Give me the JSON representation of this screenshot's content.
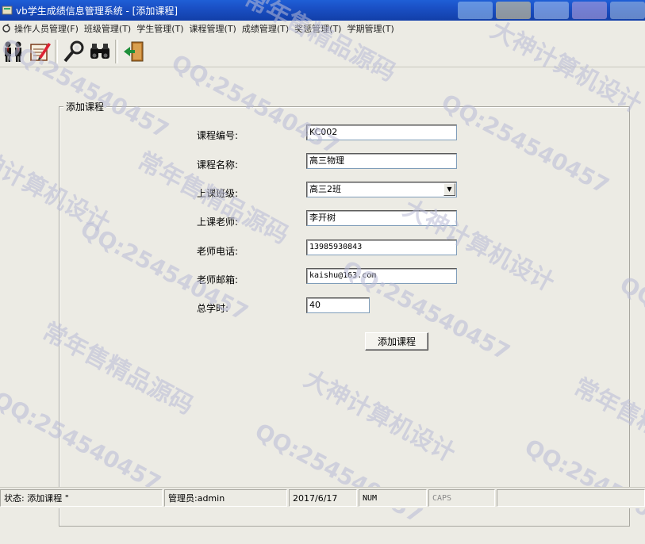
{
  "window": {
    "title": "vb学生成绩信息管理系统 - [添加课程]"
  },
  "menu": [
    "操作人员管理(F)",
    "班级管理(T)",
    "学生管理(T)",
    "课程管理(T)",
    "成绩管理(T)",
    "奖惩管理(T)",
    "学期管理(T)"
  ],
  "toolbar": {
    "tools": [
      "people-icon",
      "edit-document-icon",
      "search-key-icon",
      "binoculars-icon",
      "exit-door-icon"
    ]
  },
  "form": {
    "legend": "添加课程",
    "fields": [
      {
        "label": "课程编号:",
        "value": "KC002"
      },
      {
        "label": "课程名称:",
        "value": "高三物理"
      },
      {
        "label": "上课班级:",
        "value": "高三2班"
      },
      {
        "label": "上课老师:",
        "value": "李开树"
      },
      {
        "label": "老师电话:",
        "value": "13985930843"
      },
      {
        "label": "老师邮箱:",
        "value": "kaishu@163.com"
      },
      {
        "label": "总学时:",
        "value": "40"
      }
    ],
    "submit_label": "添加课程"
  },
  "watermark": {
    "sales": "常年售精品源码",
    "qq": "QQ:254540457",
    "design": "大神计算机设计"
  },
  "status": {
    "state": "状态:  添加课程  \"",
    "admin": "管理员:admin",
    "date": "2017/6/17",
    "num": "NUM",
    "caps": "CAPS"
  }
}
